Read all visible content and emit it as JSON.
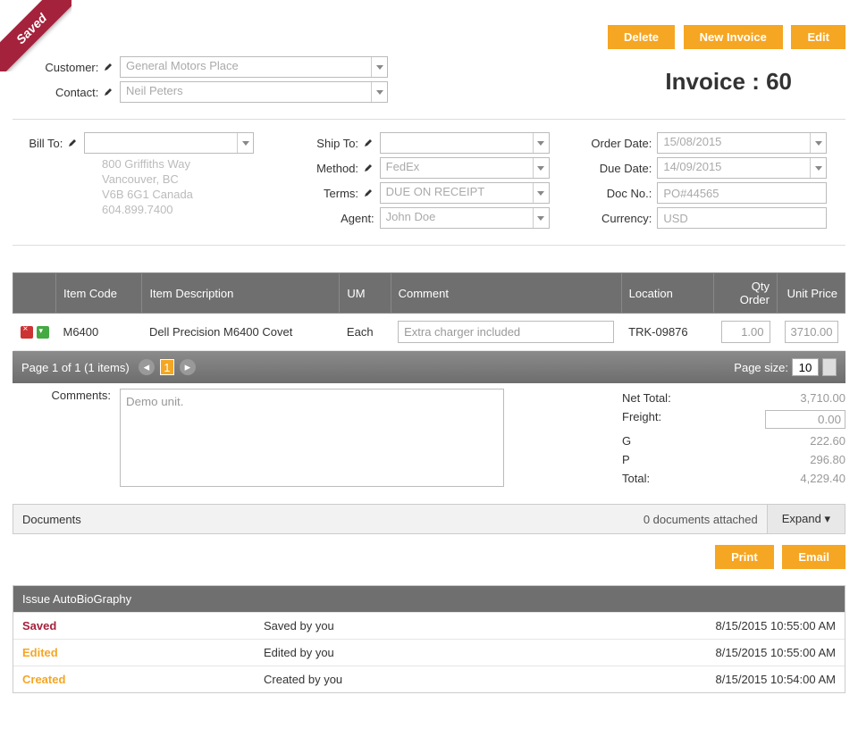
{
  "ribbon": "Saved",
  "actions": {
    "delete": "Delete",
    "new_invoice": "New Invoice",
    "edit": "Edit",
    "print": "Print",
    "email": "Email"
  },
  "header": {
    "customer_label": "Customer:",
    "customer_value": "General Motors Place",
    "contact_label": "Contact:",
    "contact_value": "Neil Peters",
    "invoice_title": "Invoice : 60"
  },
  "billto": {
    "label": "Bill To:",
    "value": "",
    "addr1": "800 Griffiths Way",
    "addr2": "Vancouver, BC",
    "addr3": "V6B 6G1 Canada",
    "addr4": "604.899.7400"
  },
  "shipcol": {
    "shipto_label": "Ship To:",
    "shipto_value": "",
    "method_label": "Method:",
    "method_value": "FedEx",
    "terms_label": "Terms:",
    "terms_value": "DUE ON RECEIPT",
    "agent_label": "Agent:",
    "agent_value": "John Doe"
  },
  "ordercol": {
    "orderdate_label": "Order Date:",
    "orderdate_value": "15/08/2015",
    "duedate_label": "Due Date:",
    "duedate_value": "14/09/2015",
    "docno_label": "Doc No.:",
    "docno_value": "PO#44565",
    "currency_label": "Currency:",
    "currency_value": "USD"
  },
  "grid": {
    "headers": {
      "code": "Item Code",
      "desc": "Item Description",
      "um": "UM",
      "comment": "Comment",
      "location": "Location",
      "qty": "Qty Order",
      "price": "Unit Price"
    },
    "rows": [
      {
        "code": "M6400",
        "desc": "Dell Precision M6400 Covet",
        "um": "Each",
        "comment": "Extra charger included",
        "location": "TRK-09876",
        "qty": "1.00",
        "price": "3710.00"
      }
    ]
  },
  "pager": {
    "text": "Page 1 of 1 (1 items)",
    "current": "1",
    "size_label": "Page size:",
    "size": "10"
  },
  "comments": {
    "label": "Comments:",
    "value": "Demo unit."
  },
  "totals": {
    "net_label": "Net Total:",
    "net": "3,710.00",
    "freight_label": "Freight:",
    "freight": "0.00",
    "g_label": "G",
    "g": "222.60",
    "p_label": "P",
    "p": "296.80",
    "total_label": "Total:",
    "total": "4,229.40"
  },
  "docs": {
    "label": "Documents",
    "count": "0 documents attached",
    "expand": "Expand"
  },
  "audit": {
    "title": "Issue AutoBioGraphy",
    "rows": [
      {
        "status": "Saved",
        "class": "saved",
        "msg": "Saved by you",
        "ts": "8/15/2015 10:55:00 AM"
      },
      {
        "status": "Edited",
        "class": "edited",
        "msg": "Edited by you",
        "ts": "8/15/2015 10:55:00 AM"
      },
      {
        "status": "Created",
        "class": "created",
        "msg": "Created by you",
        "ts": "8/15/2015 10:54:00 AM"
      }
    ]
  }
}
